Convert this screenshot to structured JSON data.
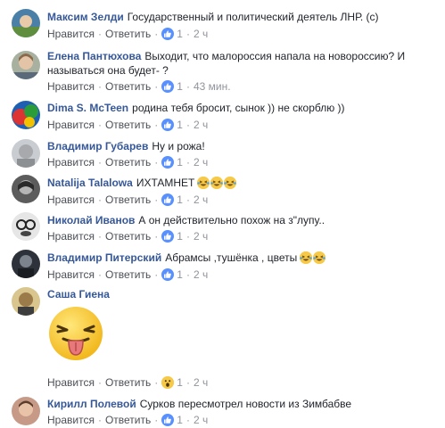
{
  "action_labels": {
    "like": "Нравится",
    "reply": "Ответить"
  },
  "comments": [
    {
      "author": "Максим Зелди",
      "text": "Государственный и политический деятель ЛНР. (с)",
      "reactions": "1",
      "reaction_type": "like",
      "time": "2 ч",
      "avatar_color": "#4a7fa8"
    },
    {
      "author": "Елена Пантюхова",
      "text": "Выходит, что малороссия напала на новороссию? И называться она будет- ?",
      "reactions": "1",
      "reaction_type": "like",
      "time": "43 мин.",
      "avatar_color": "#8a7f6a"
    },
    {
      "author": "Dima S. McTeen",
      "text": "родина тебя бросит, сынок )) не скорблю ))",
      "reactions": "1",
      "reaction_type": "like",
      "time": "2 ч",
      "avatar_color": "#c0392b"
    },
    {
      "author": "Владимир Губарев",
      "text": "Ну и рожа!",
      "reactions": "1",
      "reaction_type": "like",
      "time": "2 ч",
      "avatar_color": "#9aa0a6"
    },
    {
      "author": "Natalija Talalowa",
      "text": "ИХТАМНЕТ",
      "emojis": [
        "laughing-crying-emoji",
        "laughing-crying-emoji",
        "laughing-crying-emoji"
      ],
      "reactions": "1",
      "reaction_type": "like",
      "time": "2 ч",
      "avatar_color": "#6d6d6d"
    },
    {
      "author": "Николай Иванов",
      "text": "А он действительно похож на з\"лупу..",
      "reactions": "1",
      "reaction_type": "like",
      "time": "2 ч",
      "avatar_color": "#7a7a7a"
    },
    {
      "author": "Владимир Питерский",
      "text": "Абрамсы ,тушёнка , цветы",
      "emojis": [
        "laughing-crying-emoji",
        "laughing-crying-emoji"
      ],
      "reactions": "1",
      "reaction_type": "like",
      "time": "2 ч",
      "avatar_color": "#3a3f4a"
    },
    {
      "author": "Саша Гиена",
      "text": "",
      "sticker": "tongue-out-face-sticker",
      "reactions": "1",
      "reaction_type": "wow",
      "time": "2 ч",
      "avatar_color": "#c8b37a"
    },
    {
      "author": "Кирилл Полевой",
      "text": "Сурков пересмотрел новости из Зимбабве",
      "reactions": "1",
      "reaction_type": "like",
      "time": "2 ч",
      "avatar_color": "#b07a6a"
    }
  ]
}
